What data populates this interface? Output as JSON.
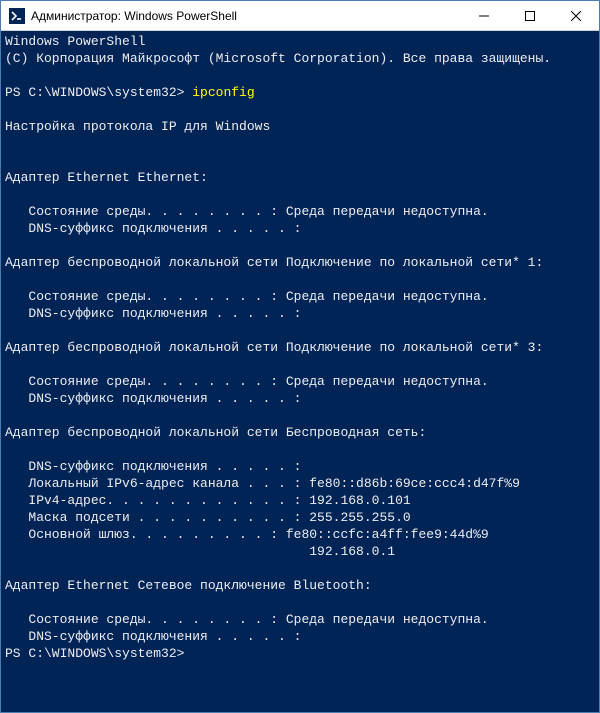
{
  "window": {
    "title": "Администратор: Windows PowerShell"
  },
  "colors": {
    "terminal_bg": "#012456",
    "terminal_fg": "#eeedf0",
    "command_fg": "#ffff00"
  },
  "terminal": {
    "header_line1": "Windows PowerShell",
    "header_line2": "(C) Корпорация Майкрософт (Microsoft Corporation). Все права защищены.",
    "prompt1_prefix": "PS C:\\WINDOWS\\system32> ",
    "prompt1_command": "ipconfig",
    "config_title": "Настройка протокола IP для Windows",
    "adapters": [
      {
        "name": "Адаптер Ethernet Ethernet:",
        "lines": [
          "   Состояние среды. . . . . . . . : Среда передачи недоступна.",
          "   DNS-суффикс подключения . . . . . :"
        ]
      },
      {
        "name": "Адаптер беспроводной локальной сети Подключение по локальной сети* 1:",
        "lines": [
          "   Состояние среды. . . . . . . . : Среда передачи недоступна.",
          "   DNS-суффикс подключения . . . . . :"
        ]
      },
      {
        "name": "Адаптер беспроводной локальной сети Подключение по локальной сети* 3:",
        "lines": [
          "   Состояние среды. . . . . . . . : Среда передачи недоступна.",
          "   DNS-суффикс подключения . . . . . :"
        ]
      },
      {
        "name": "Адаптер беспроводной локальной сети Беспроводная сеть:",
        "lines": [
          "   DNS-суффикс подключения . . . . . :",
          "   Локальный IPv6-адрес канала . . . : fe80::d86b:69ce:ccc4:d47f%9",
          "   IPv4-адрес. . . . . . . . . . . . : 192.168.0.101",
          "   Маска подсети . . . . . . . . . . : 255.255.255.0",
          "   Основной шлюз. . . . . . . . . : fe80::ccfc:a4ff:fee9:44d%9",
          "                                       192.168.0.1"
        ]
      },
      {
        "name": "Адаптер Ethernet Сетевое подключение Bluetooth:",
        "lines": [
          "   Состояние среды. . . . . . . . : Среда передачи недоступна.",
          "   DNS-суффикс подключения . . . . . :"
        ]
      }
    ],
    "prompt2": "PS C:\\WINDOWS\\system32>"
  }
}
